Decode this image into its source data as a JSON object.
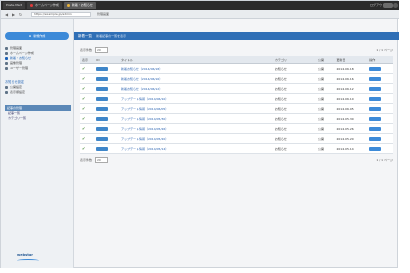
{
  "browser": {
    "tabs": [
      {
        "label": "Poste-Mart"
      },
      {
        "label": "ホームページ作成"
      },
      {
        "label": "新着・お知らせ"
      }
    ],
    "top_right_text": "ログアウト",
    "url": "https://example.jp/admin",
    "crumb": "管理画面"
  },
  "sidebar": {
    "new_button": "新規作成",
    "top_items": [
      {
        "label": "管理画面"
      },
      {
        "label": "ホームページ作成"
      },
      {
        "label": "新着・お知らせ"
      },
      {
        "label": "画像管理"
      },
      {
        "label": "ユーザー管理"
      }
    ],
    "section_head": "お知らせ設定",
    "section_items": [
      {
        "label": "公開設定"
      },
      {
        "label": "表示順設定"
      }
    ],
    "sub_header": "記事の管理",
    "links": [
      {
        "label": "記事一覧"
      },
      {
        "label": "カテゴリ一覧"
      }
    ],
    "logo": "webstar"
  },
  "main": {
    "header_title": "新着一覧",
    "header_sub": "新着記事の一覧を表示",
    "per_page_label": "表示件数",
    "per_page_value": "20",
    "pager_text": "1 / 1 ページ",
    "columns": [
      "表示",
      "ID",
      "タイトル",
      "カテゴリ",
      "公開",
      "更新日",
      "操作"
    ],
    "rows": [
      {
        "title": "新着お知らせ（2014/06/18）",
        "category": "お知らせ",
        "status": "公開",
        "date": "2014.06.18"
      },
      {
        "title": "新着お知らせ（2014/06/16）",
        "category": "お知らせ",
        "status": "公開",
        "date": "2014.06.16"
      },
      {
        "title": "新着お知らせ（2014/06/12）",
        "category": "お知らせ",
        "status": "公開",
        "date": "2014.06.12"
      },
      {
        "title": "アップデート情報（2014/06/10）",
        "category": "お知らせ",
        "status": "公開",
        "date": "2014.06.10"
      },
      {
        "title": "アップデート情報（2014/06/05）",
        "category": "お知らせ",
        "status": "公開",
        "date": "2014.06.05"
      },
      {
        "title": "アップデート情報（2014/05/30）",
        "category": "お知らせ",
        "status": "公開",
        "date": "2014.05.30"
      },
      {
        "title": "アップデート情報（2014/05/26）",
        "category": "お知らせ",
        "status": "公開",
        "date": "2014.05.26"
      },
      {
        "title": "アップデート情報（2014/05/20）",
        "category": "お知らせ",
        "status": "公開",
        "date": "2014.05.20"
      },
      {
        "title": "アップデート情報（2014/05/14）",
        "category": "お知らせ",
        "status": "公開",
        "date": "2014.05.14"
      }
    ]
  }
}
